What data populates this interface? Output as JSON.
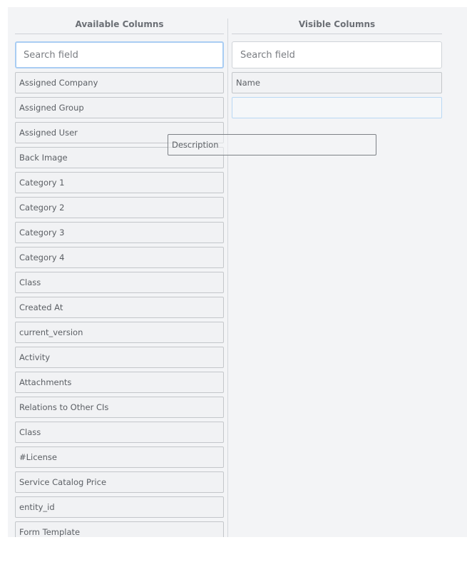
{
  "available": {
    "title": "Available Columns",
    "search_placeholder": "Search field",
    "items": [
      "Assigned Company",
      "Assigned Group",
      "Assigned User",
      "Back Image",
      "Category 1",
      "Category 2",
      "Category 3",
      "Category 4",
      "Class",
      "Created At",
      "current_version",
      "Activity",
      "Attachments",
      "Relations to Other CIs",
      "Class",
      "#License",
      "Service Catalog Price",
      "entity_id",
      "Form Template"
    ]
  },
  "visible": {
    "title": "Visible Columns",
    "search_placeholder": "Search field",
    "items": [
      "Name"
    ]
  },
  "drag": {
    "label": "Description"
  }
}
